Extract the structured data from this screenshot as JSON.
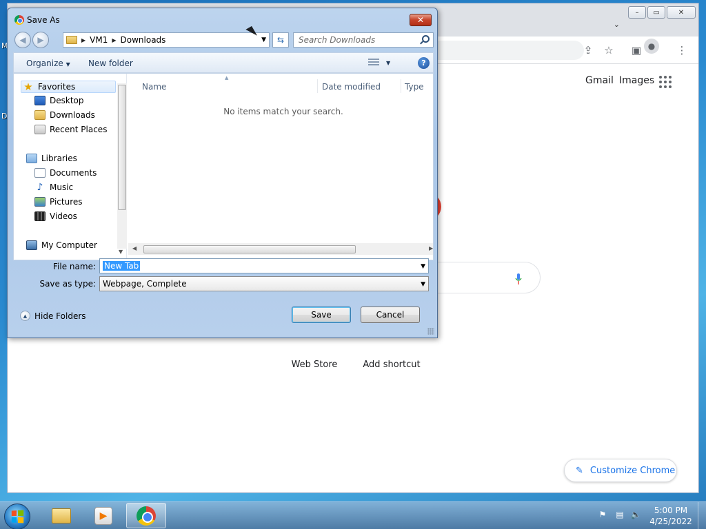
{
  "desktop": {
    "left_labels": [
      "M",
      "D"
    ]
  },
  "chrome_window": {
    "top_links": {
      "gmail": "Gmail",
      "images": "Images"
    },
    "shortcuts": [
      {
        "label": "Web Store"
      },
      {
        "label": "Add shortcut"
      }
    ],
    "customize_label": "Customize Chrome",
    "icons": [
      "share-icon",
      "bookmark-star-icon",
      "side-panel-icon",
      "profile-icon",
      "kebab-menu-icon",
      "apps-grid-icon",
      "mic-icon",
      "pencil-icon"
    ]
  },
  "dialog": {
    "title": "Save As",
    "close_glyph": "✕",
    "breadcrumb": [
      "VM1",
      "Downloads"
    ],
    "search_placeholder": "Search Downloads",
    "commands": {
      "organize": "Organize",
      "new_folder": "New folder"
    },
    "nav": {
      "favorites": {
        "label": "Favorites",
        "items": [
          {
            "label": "Desktop"
          },
          {
            "label": "Downloads"
          },
          {
            "label": "Recent Places"
          }
        ]
      },
      "libraries": {
        "label": "Libraries",
        "items": [
          {
            "label": "Documents"
          },
          {
            "label": "Music"
          },
          {
            "label": "Pictures"
          },
          {
            "label": "Videos"
          }
        ]
      },
      "computer": {
        "label": "My Computer"
      }
    },
    "columns": [
      "Name",
      "Date modified",
      "Type"
    ],
    "empty_message": "No items match your search.",
    "file_name": {
      "label": "File name:",
      "value": "New Tab"
    },
    "save_as_type": {
      "label": "Save as type:",
      "value": "Webpage, Complete"
    },
    "hide_folders_label": "Hide Folders",
    "buttons": {
      "save": "Save",
      "cancel": "Cancel"
    }
  },
  "taskbar": {
    "clock": {
      "time": "5:00 PM",
      "date": "4/25/2022"
    },
    "pinned": [
      "windows-explorer",
      "media-player",
      "google-chrome"
    ]
  },
  "colors": {
    "selection": "#3399ff",
    "chrome_blue": "#1a73e8",
    "dialog_frame": "#a9c6e8"
  }
}
